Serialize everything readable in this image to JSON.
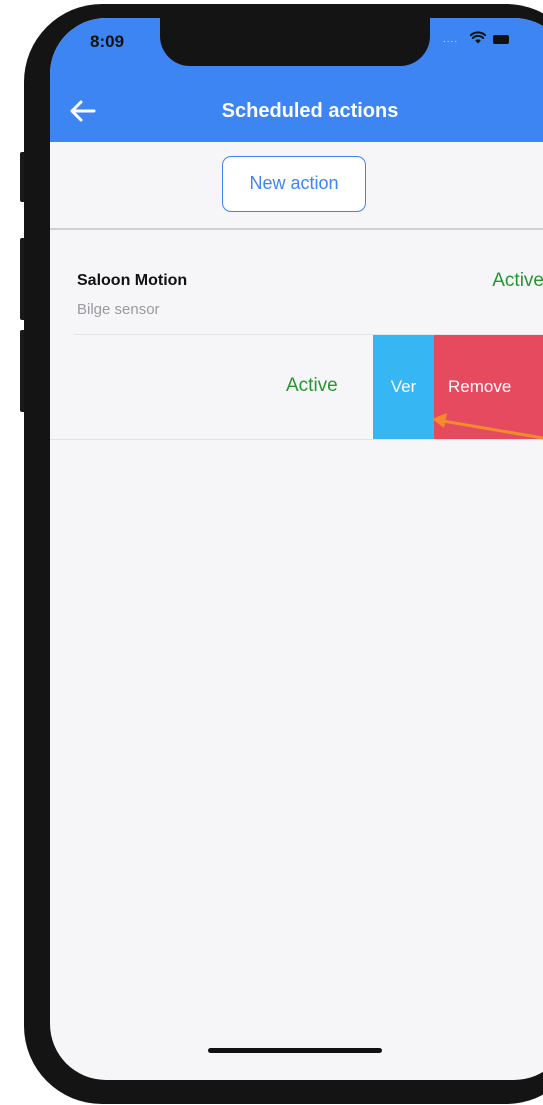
{
  "status_bar": {
    "time": "8:09",
    "dots": "....",
    "wifi_icon": "wifi-icon",
    "battery_icon": "battery-icon"
  },
  "header": {
    "title": "Scheduled actions",
    "back_icon": "arrow-left-icon"
  },
  "toolbar": {
    "new_action_label": "New action"
  },
  "actions": [
    {
      "title": "Saloon Motion",
      "subtitle": "Bilge sensor",
      "status": "Active"
    },
    {
      "status": "Active",
      "swipe_actions": {
        "view_label": "Ver",
        "remove_label": "Remove"
      }
    }
  ],
  "colors": {
    "header": "#3d85f3",
    "active_text": "#25962f",
    "view_action": "#36b7f4",
    "remove_action": "#e64a5f",
    "annotation_arrow": "#f28b2f"
  }
}
